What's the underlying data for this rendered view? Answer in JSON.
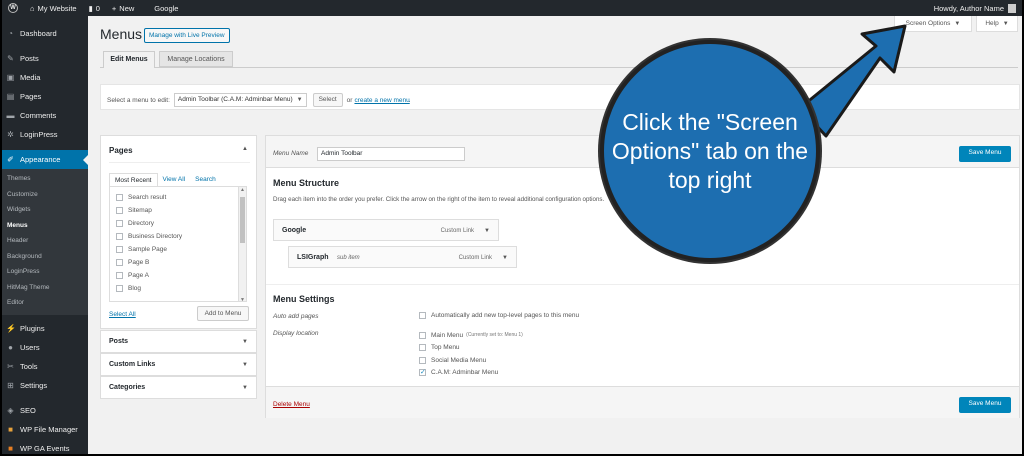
{
  "adminbar": {
    "wp": "W",
    "site": "My Website",
    "comments": "0",
    "new": "New",
    "google": "Google",
    "howdy": "Howdy, Author Name"
  },
  "sidebar": {
    "dashboard": "Dashboard",
    "posts": "Posts",
    "media": "Media",
    "pages": "Pages",
    "comments": "Comments",
    "loginpress": "LoginPress",
    "appearance": "Appearance",
    "sub": [
      "Themes",
      "Customize",
      "Widgets",
      "Menus",
      "Header",
      "Background",
      "LoginPress",
      "HitMag Theme",
      "Editor"
    ],
    "plugins": "Plugins",
    "users": "Users",
    "tools": "Tools",
    "settings": "Settings",
    "seo": "SEO",
    "wpfm": "WP File Manager",
    "wpga": "WP GA Events"
  },
  "screen_options": "Screen Options",
  "help": "Help",
  "page_title": "Menus",
  "manage_live": "Manage with Live Preview",
  "tabs": {
    "edit": "Edit Menus",
    "locations": "Manage Locations"
  },
  "select_bar": {
    "label": "Select a menu to edit:",
    "selected": "Admin Toolbar (C.A.M: Adminbar Menu)",
    "select_btn": "Select",
    "or": "or",
    "create": "create a new menu",
    "period": "."
  },
  "left": {
    "pages_title": "Pages",
    "tabs": [
      "Most Recent",
      "View All",
      "Search"
    ],
    "items": [
      "Search result",
      "Sitemap",
      "Directory",
      "Business Directory",
      "Sample Page",
      "Page B",
      "Page A",
      "Blog"
    ],
    "select_all": "Select All",
    "add_btn": "Add to Menu",
    "sections": [
      "Posts",
      "Custom Links",
      "Categories"
    ]
  },
  "right": {
    "menu_name_label": "Menu Name",
    "menu_name_value": "Admin Toolbar",
    "save": "Save Menu",
    "structure_title": "Menu Structure",
    "structure_desc": "Drag each item into the order you prefer. Click the arrow on the right of the item to reveal additional configuration options.",
    "item1": {
      "title": "Google",
      "type": "Custom Link"
    },
    "item2": {
      "title": "LSIGraph",
      "sub": "sub item",
      "type": "Custom Link"
    },
    "settings_title": "Menu Settings",
    "auto_label": "Auto add pages",
    "auto_text": "Automatically add new top-level pages to this menu",
    "display_label": "Display location",
    "locations": [
      {
        "name": "Main Menu",
        "note": "(Currently set to: Menu 1)",
        "checked": false
      },
      {
        "name": "Top Menu",
        "note": "",
        "checked": false
      },
      {
        "name": "Social Media Menu",
        "note": "",
        "checked": false
      },
      {
        "name": "C.A.M: Adminbar Menu",
        "note": "",
        "checked": true
      }
    ],
    "delete": "Delete Menu"
  },
  "callout": "Click the \"Screen Options\" tab on the top right",
  "colors": {
    "accent": "#0073aa",
    "callout": "#1d6eb0",
    "adminbar": "#23282d"
  }
}
